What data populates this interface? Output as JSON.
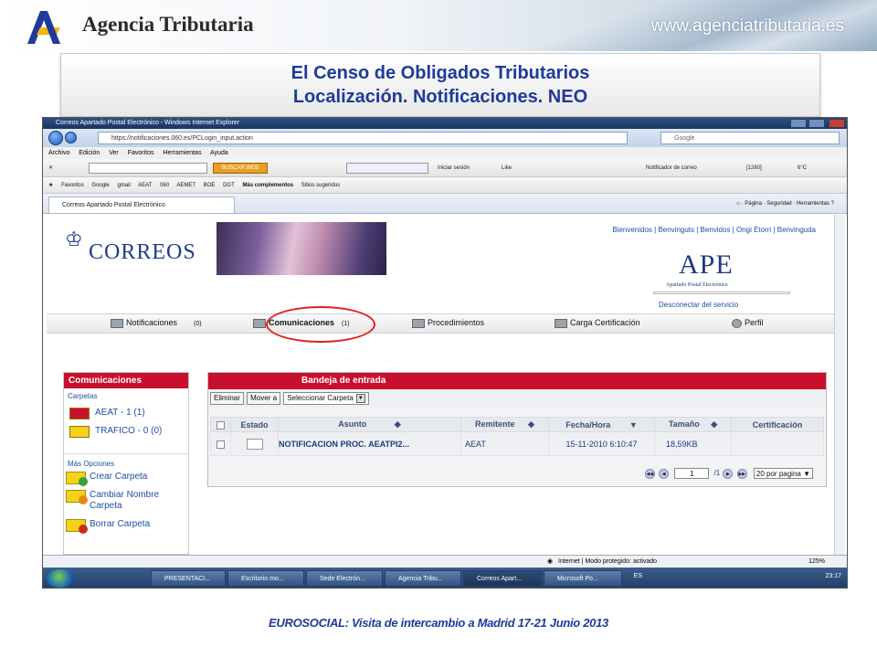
{
  "slide": {
    "brand": "Agencia Tributaria",
    "website": "www.agenciatributaria.es",
    "title_line1": "El Censo de Obligados Tributarios",
    "title_line2": "Localización. Notificaciones. NEO",
    "footer": "EUROSOCIAL: Visita de intercambio a Madrid 17-21 Junio 2013"
  },
  "browser": {
    "window_title": "Correos Apartado Postal Electrónico - Windows Internet Explorer",
    "address": "https://notificaciones.060.es/PCLogin_input.action",
    "search_placeholder": "Google",
    "menu": [
      "Archivo",
      "Edición",
      "Ver",
      "Favoritos",
      "Herramientas",
      "Ayuda"
    ],
    "toolbar": {
      "buscar": "BUSCAR WEB",
      "login": "Iniciar sesión",
      "like": "Like",
      "notifier": "Notificador de correo",
      "rss": "[1260]",
      "weather": "6°C"
    },
    "favorites": [
      "Favoritos",
      "Google",
      "gmail",
      "AEAT",
      "060",
      "AEMET",
      "BOE",
      "DGT",
      "Más complementos",
      "Sitios sugeridos"
    ],
    "tab_label": "Correos Apartado Postal Electrónico",
    "commands": [
      "Página",
      "Seguridad",
      "Herramientas"
    ],
    "status_text": "Internet | Modo protegido: activado",
    "zoom": "125%"
  },
  "app": {
    "logo_text": "CORREOS",
    "top_links": "Bienvenidos | Benvinguts | Benvidos | Ongi Etorri | Benvinguda",
    "ape_title": "APE",
    "ape_subtitle": "Apartado Postal Electrónico",
    "disconnect": "Desconectar del servicio",
    "nav": [
      {
        "label": "Notificaciones",
        "count": "(0)"
      },
      {
        "label": "Comunicaciones",
        "count": "(1)"
      },
      {
        "label": "Procedimientos",
        "count": ""
      },
      {
        "label": "Carga Certificación",
        "count": ""
      },
      {
        "label": "Perfil",
        "count": ""
      }
    ],
    "sidebar": {
      "header": "Comunicaciones",
      "folders_label": "Carpetas",
      "folders": [
        {
          "label": "AEAT - 1 (1)",
          "color": "#c8102e"
        },
        {
          "label": "TRAFICO - 0 (0)",
          "color": "#f4d21a"
        }
      ],
      "more_label": "Más Opciones",
      "options": [
        {
          "label": "Crear Carpeta",
          "badge": "#3aa13a"
        },
        {
          "label": "Cambiar Nombre Carpeta",
          "badge": "#e08a1a"
        },
        {
          "label": "Borrar Carpeta",
          "badge": "#d02a1a"
        }
      ]
    },
    "inbox": {
      "header": "Bandeja de entrada",
      "buttons": [
        "Eliminar",
        "Mover a"
      ],
      "folder_select": "Seleccionar Carpeta",
      "columns": [
        "Estado",
        "Asunto",
        "Remitente",
        "Fecha/Hora",
        "Tamaño",
        "Certificación"
      ],
      "rows": [
        {
          "asunto": "NOTIFICACION PROC. AEATPI2...",
          "remitente": "AEAT",
          "fecha": "15-11-2010 6:10:47",
          "tamano": "18,59KB",
          "certificacion": ""
        }
      ],
      "pager": {
        "page": "1",
        "of": "/1",
        "per_page": "20 por pagina"
      }
    }
  },
  "taskbar": {
    "items": [
      "PRESENTACI...",
      "Escritorio mo...",
      "Sede Electrón...",
      "Agencia Tribu...",
      "Correos Apart...",
      "Microsoft Po..."
    ],
    "active_index": 4,
    "lang": "ES",
    "clock": "23:17"
  }
}
